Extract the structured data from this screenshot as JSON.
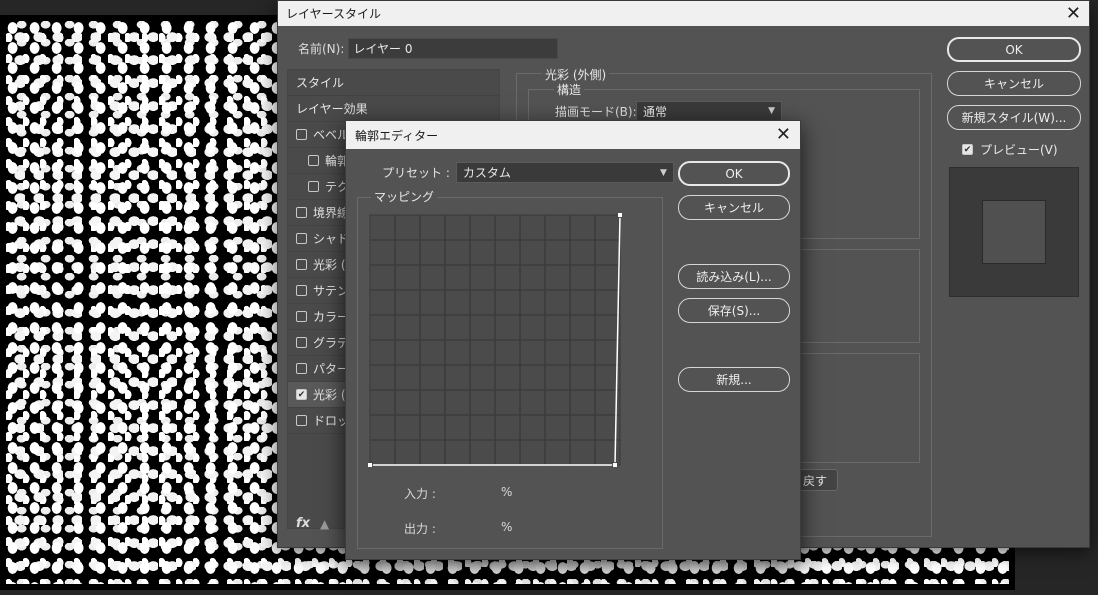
{
  "layer_style": {
    "title": "レイヤースタイル",
    "name_label": "名前(N):",
    "name_value": "レイヤー 0",
    "list_header": "スタイル",
    "list_items": [
      {
        "label": "レイヤー効果",
        "checkbox": false,
        "checked": false,
        "sub": false
      },
      {
        "label": "ベベルと",
        "checkbox": true,
        "checked": false,
        "sub": false
      },
      {
        "label": "輪郭",
        "checkbox": true,
        "checked": false,
        "sub": true
      },
      {
        "label": "テクス",
        "checkbox": true,
        "checked": false,
        "sub": true
      },
      {
        "label": "境界線",
        "checkbox": true,
        "checked": false,
        "sub": false
      },
      {
        "label": "シャドウ",
        "checkbox": true,
        "checked": false,
        "sub": false
      },
      {
        "label": "光彩 (I",
        "checkbox": true,
        "checked": false,
        "sub": false
      },
      {
        "label": "サテン",
        "checkbox": true,
        "checked": false,
        "sub": false
      },
      {
        "label": "カラーオ",
        "checkbox": true,
        "checked": false,
        "sub": false
      },
      {
        "label": "グラデー",
        "checkbox": true,
        "checked": false,
        "sub": false
      },
      {
        "label": "パターン",
        "checkbox": true,
        "checked": false,
        "sub": false
      },
      {
        "label": "光彩 (",
        "checkbox": true,
        "checked": true,
        "sub": false,
        "selected": true
      },
      {
        "label": "ドロップ",
        "checkbox": true,
        "checked": false,
        "sub": false
      }
    ],
    "fx_label": "fx",
    "panel_title": "光彩 (外側)",
    "structure_title": "構造",
    "blend_mode_label": "描画モード(B):",
    "blend_mode_value": "通常",
    "reset_button_partial": "戻す",
    "ok": "OK",
    "cancel": "キャンセル",
    "new_style": "新規スタイル(W)...",
    "preview_label": "プレビュー(V)",
    "preview_checked": true
  },
  "contour_editor": {
    "title": "輪郭エディター",
    "preset_label": "プリセット :",
    "preset_value": "カスタム",
    "mapping_title": "マッピング",
    "input_label": "入力 :",
    "output_label": "出力 :",
    "percent": "%",
    "ok": "OK",
    "cancel": "キャンセル",
    "load": "読み込み(L)...",
    "save": "保存(S)...",
    "new": "新規...",
    "curve_points": [
      {
        "input": 0,
        "output": 0
      },
      {
        "input": 98,
        "output": 0
      },
      {
        "input": 100,
        "output": 100
      }
    ],
    "grid_divisions": 10
  },
  "colors": {
    "dialog_bg": "#535353",
    "titlebar_bg": "#f0f0f0",
    "curve": "#ffffff"
  }
}
